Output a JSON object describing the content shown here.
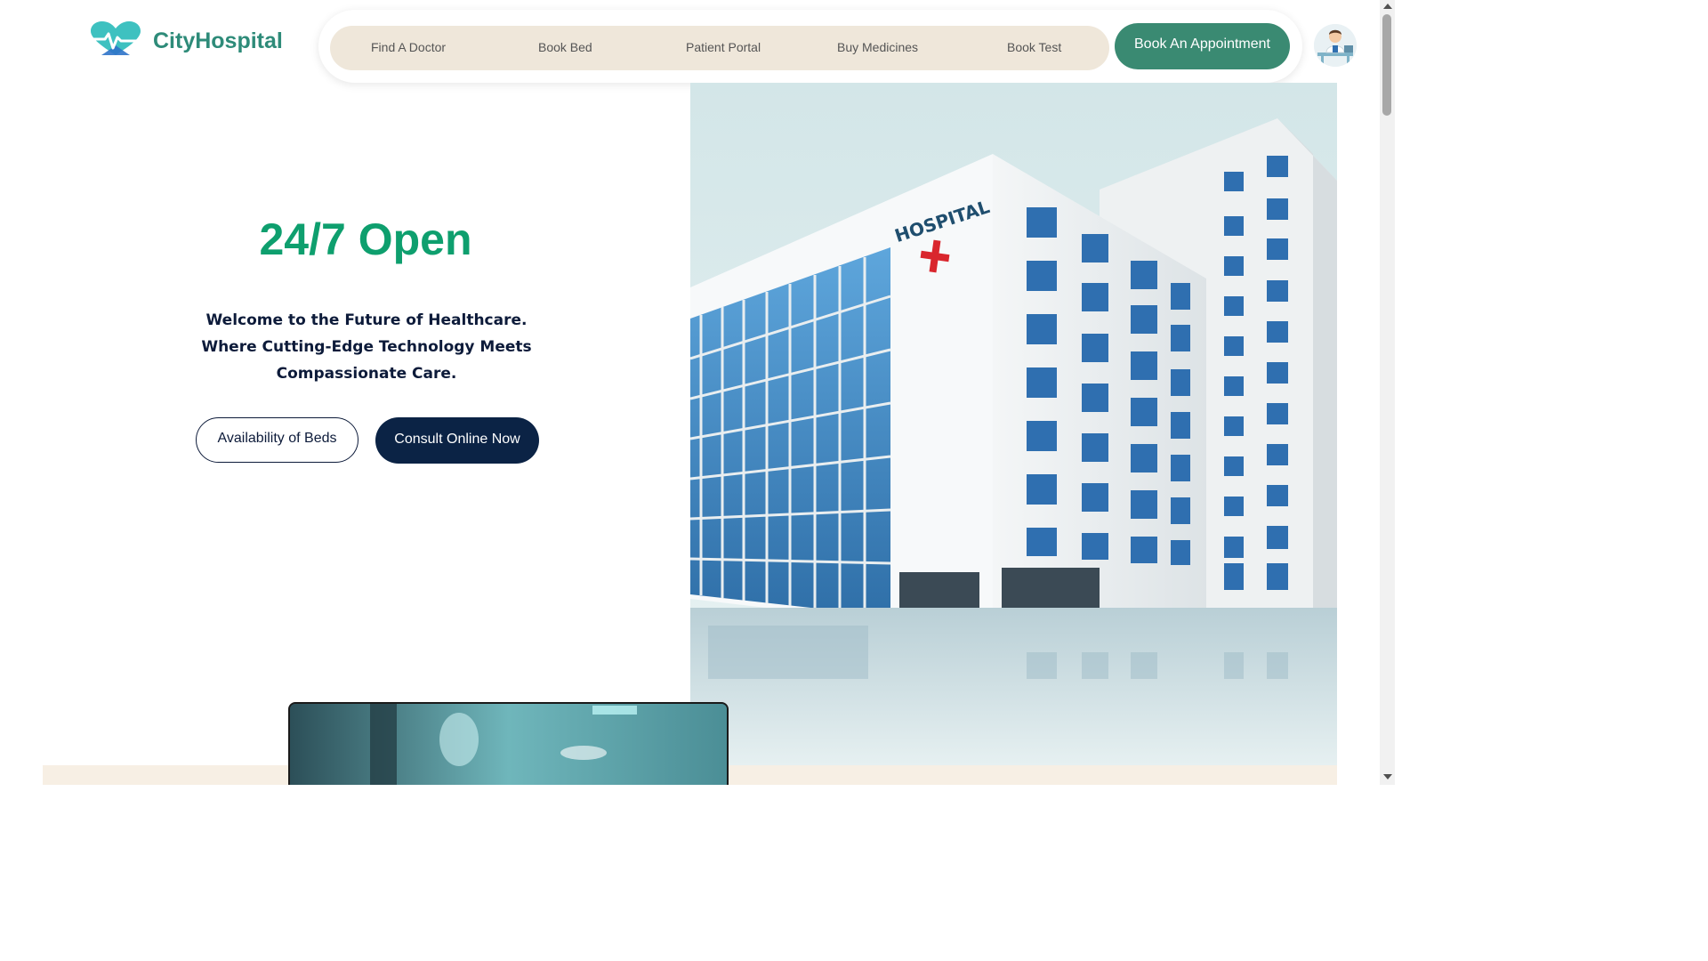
{
  "brand": {
    "name": "CityHospital",
    "colors": {
      "primary": "#2e8b79",
      "accent_green": "#0e9f6e",
      "dark_navy": "#0b2345",
      "nav_pill": "#efe7da"
    },
    "logo_icon": "heart-pulse-icon"
  },
  "nav": {
    "items": [
      {
        "label": "Find A Doctor"
      },
      {
        "label": "Book Bed"
      },
      {
        "label": "Patient Portal"
      },
      {
        "label": "Buy Medicines"
      },
      {
        "label": "Book Test"
      }
    ],
    "cta_label": "Book An Appointment",
    "avatar_icon": "doctor-avatar-icon"
  },
  "hero": {
    "title": "24/7 Open",
    "line1": "Welcome to the Future of Healthcare.",
    "line2": "Where Cutting-Edge Technology Meets",
    "line3": "Compassionate Care.",
    "btn_beds": "Availability of Beds",
    "btn_consult": "Consult Online Now"
  },
  "illustration": {
    "sign_text": "HOSPITAL",
    "icon": "hospital-building-illustration"
  }
}
